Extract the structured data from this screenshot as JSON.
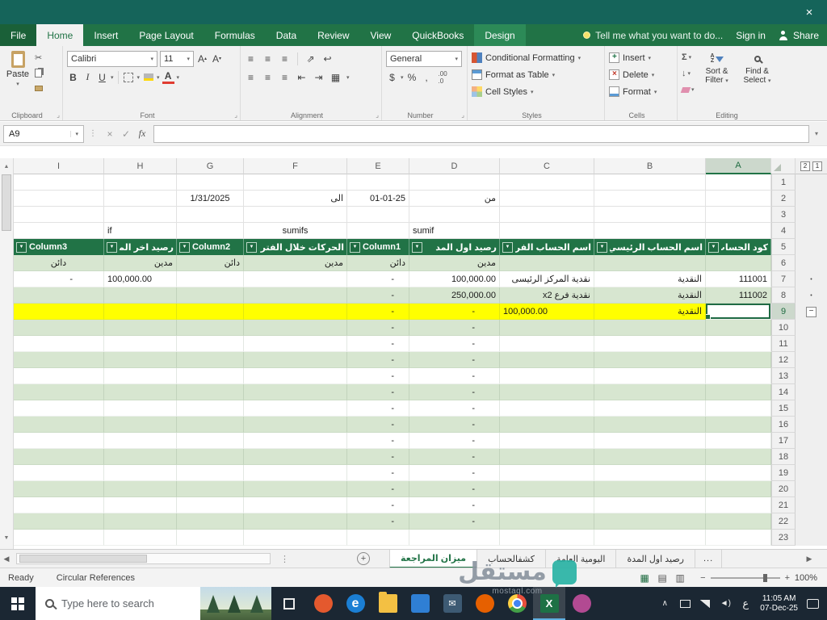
{
  "window": {
    "close": "×"
  },
  "ribbon_tabs": [
    {
      "label": "File",
      "kind": "file"
    },
    {
      "label": "Home",
      "active": true
    },
    {
      "label": "Insert"
    },
    {
      "label": "Page Layout"
    },
    {
      "label": "Formulas"
    },
    {
      "label": "Data"
    },
    {
      "label": "Review"
    },
    {
      "label": "View"
    },
    {
      "label": "QuickBooks"
    },
    {
      "label": "Design",
      "kind": "context"
    }
  ],
  "topbar": {
    "tellme": "Tell me what you want to do...",
    "signin": "Sign in",
    "share": "Share"
  },
  "ribbon": {
    "paste": "Paste",
    "clipboard_label": "Clipboard",
    "font_family": "Calibri",
    "font_size": "11",
    "bold": "B",
    "italic": "I",
    "underline": "U",
    "font_label": "Font",
    "alignment_label": "Alignment",
    "number_format": "General",
    "currency": "$",
    "percent": "%",
    "comma": ",",
    "dec_inc": ".00",
    "dec_dec": ".0",
    "number_label": "Number",
    "conditional": "Conditional Formatting",
    "format_table": "Format as Table",
    "cell_styles": "Cell Styles",
    "styles_label": "Styles",
    "insert": "Insert",
    "delete": "Delete",
    "format": "Format",
    "cells_label": "Cells",
    "autosum": "Σ",
    "sort1": "Sort &",
    "sort2": "Filter",
    "find1": "Find &",
    "find2": "Select",
    "editing_label": "Editing"
  },
  "formula_bar": {
    "name_box": "A9",
    "fx": "fx"
  },
  "sheet": {
    "display_columns": [
      "I",
      "H",
      "G",
      "F",
      "E",
      "D",
      "C",
      "B",
      "A"
    ],
    "col_widths": {
      "I": 112,
      "H": 90,
      "G": 83,
      "F": 128,
      "E": 77,
      "D": 112,
      "C": 117,
      "B": 138,
      "A": 81
    },
    "selected_column": "A",
    "selected_cell": "A9",
    "rows_count": 23,
    "header_row": 5,
    "subheader_row": 6,
    "outline_levels": [
      "2",
      "1"
    ],
    "outline_dot_rows": [
      7,
      8
    ],
    "outline_collapse_row": 9,
    "headers": {
      "A": "كود الحساب",
      "B": "اسم الحساب الرئيسي",
      "C": "اسم الحساب الفرعي",
      "D": "رصيد اول المد",
      "E": "Column1",
      "F": "الحركات خلال الفتر",
      "G": "Column2",
      "H": "رصيد اخر المد",
      "I": "Column3"
    },
    "subheaders": {
      "D": "مدين",
      "E": "دائن",
      "F": "مدين",
      "G": "دائن",
      "H": "مدين",
      "I": "دائن"
    },
    "free_cells": [
      {
        "r": 2,
        "c": "D",
        "v": "من",
        "align": "right"
      },
      {
        "r": 2,
        "c": "E",
        "v": "01-01-25",
        "align": "right"
      },
      {
        "r": 2,
        "c": "F",
        "v": "الى",
        "align": "right"
      },
      {
        "r": 2,
        "c": "G",
        "v": "1/31/2025",
        "align": "center"
      },
      {
        "r": 4,
        "c": "D",
        "v": "sumif",
        "align": "left"
      },
      {
        "r": 4,
        "c": "F",
        "v": "sumifs",
        "align": "center"
      },
      {
        "r": 4,
        "c": "H",
        "v": "if",
        "align": "left"
      }
    ],
    "table_rows": [
      {
        "r": 7,
        "cells": {
          "A": "111001",
          "B": "النقدية",
          "C": "نقدية المركز الرئيسى",
          "D": "100,000.00",
          "E": "-",
          "H": "100,000.00",
          "I": "-"
        },
        "aligns": {
          "H": "left"
        }
      },
      {
        "r": 8,
        "cells": {
          "A": "111002",
          "B": "النقدية",
          "C": "نقدية فرع x2",
          "D": "250,000.00",
          "E": "-"
        }
      },
      {
        "r": 9,
        "cells": {
          "B": "النقدية",
          "C": "100,000.00",
          "D": "-",
          "E": "-"
        },
        "aligns": {
          "C": "left"
        },
        "highlight": "yellow"
      }
    ],
    "dash_rows": [
      10,
      11,
      12,
      13,
      14,
      15,
      16,
      17,
      18,
      19,
      20,
      21,
      22
    ]
  },
  "sheet_tabs": {
    "items": [
      {
        "label": "ميزان المراجعة",
        "active": true
      },
      {
        "label": "كشفالحساب"
      },
      {
        "label": "اليومية العامة"
      },
      {
        "label": "رصيد اول المدة"
      }
    ],
    "overflow": "..."
  },
  "status_bar": {
    "ready": "Ready",
    "circular": "Circular References",
    "zoom": "100%"
  },
  "taskbar": {
    "search_placeholder": "Type here to search",
    "language": "ع",
    "time": "11:05 AM",
    "date": "07-Dec-25",
    "apps": [
      {
        "name": "opera-icon",
        "kind": "circle",
        "color": "#e4592e"
      },
      {
        "name": "edge-icon",
        "kind": "circle",
        "color": "#1b7fd4",
        "glyph": "e"
      },
      {
        "name": "file-explorer-icon",
        "kind": "folder",
        "color": "#f3c043"
      },
      {
        "name": "store-icon",
        "kind": "square",
        "color": "#2f7fd4"
      },
      {
        "name": "mail-icon",
        "kind": "square",
        "color": "#3d5a73",
        "glyph": "✉"
      },
      {
        "name": "firefox-icon",
        "kind": "circle",
        "color": "#e66000"
      },
      {
        "name": "chrome-icon",
        "kind": "chrome"
      },
      {
        "name": "excel-icon",
        "kind": "excel",
        "color": "#1e7145",
        "glyph": "X",
        "active": true
      },
      {
        "name": "photos-icon",
        "kind": "circle",
        "color": "#b24a92"
      }
    ]
  },
  "watermark": {
    "name": "مستقل",
    "domain": "mostaql.com"
  }
}
